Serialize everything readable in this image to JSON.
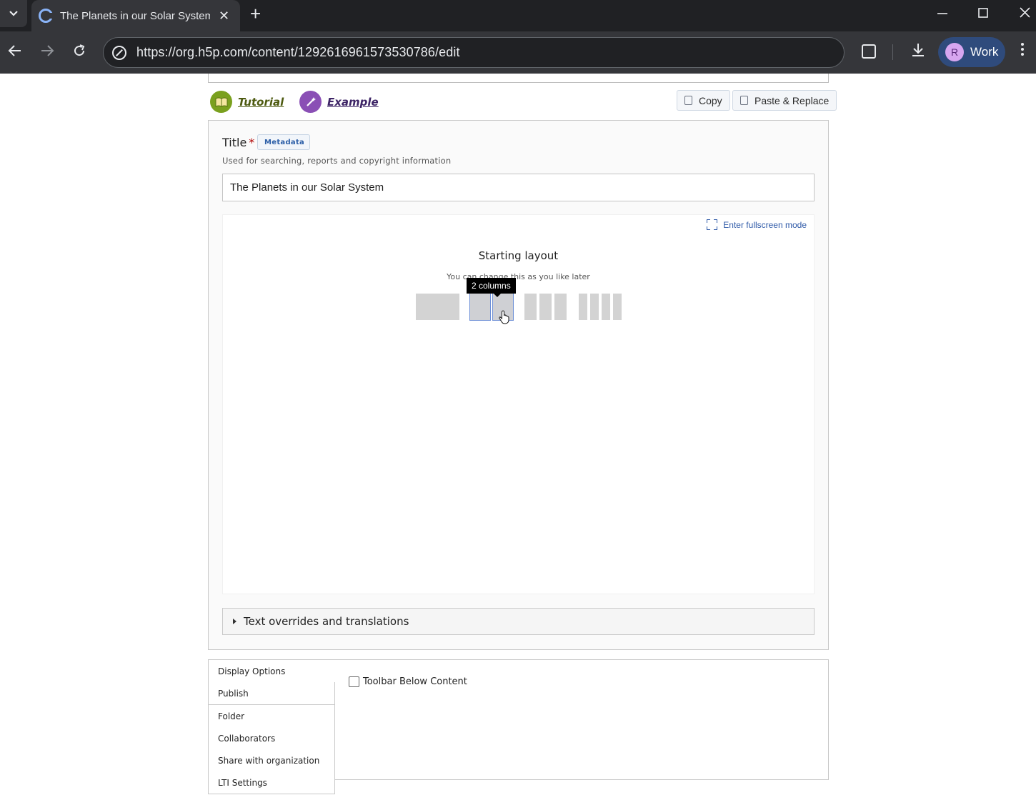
{
  "browser": {
    "tab_title": "The Planets in our Solar System",
    "url": "https://org.h5p.com/content/1292616961573530786/edit",
    "profile_initial": "R",
    "profile_label": "Work"
  },
  "header": {
    "tutorial_label": "Tutorial",
    "example_label": "Example",
    "copy_label": "Copy",
    "paste_label": "Paste & Replace"
  },
  "title_field": {
    "label": "Title",
    "required_mark": "*",
    "metadata_label": "Metadata",
    "description": "Used for searching, reports and copyright information",
    "value": "The Planets in our Solar System"
  },
  "canvas": {
    "fullscreen_label": "Enter fullscreen mode",
    "layout_title": "Starting layout",
    "layout_subtitle": "You can change this as you like later",
    "tooltip": "2 columns",
    "layout_options": [
      1,
      2,
      3,
      4
    ],
    "hovered_option": 2
  },
  "overrides": {
    "label": "Text overrides and translations"
  },
  "settings": {
    "tabs": [
      {
        "label": "Display Options",
        "active": true
      },
      {
        "label": "Publish"
      },
      {
        "label": "Folder"
      },
      {
        "label": "Collaborators"
      },
      {
        "label": "Share with organization"
      },
      {
        "label": "LTI Settings"
      }
    ],
    "checkbox_label": "Toolbar Below Content",
    "checkbox_checked": false
  },
  "colors": {
    "tutorial_green": "#7aa01e",
    "example_purple": "#8a4fb5",
    "link_blue": "#2f5aa8"
  }
}
